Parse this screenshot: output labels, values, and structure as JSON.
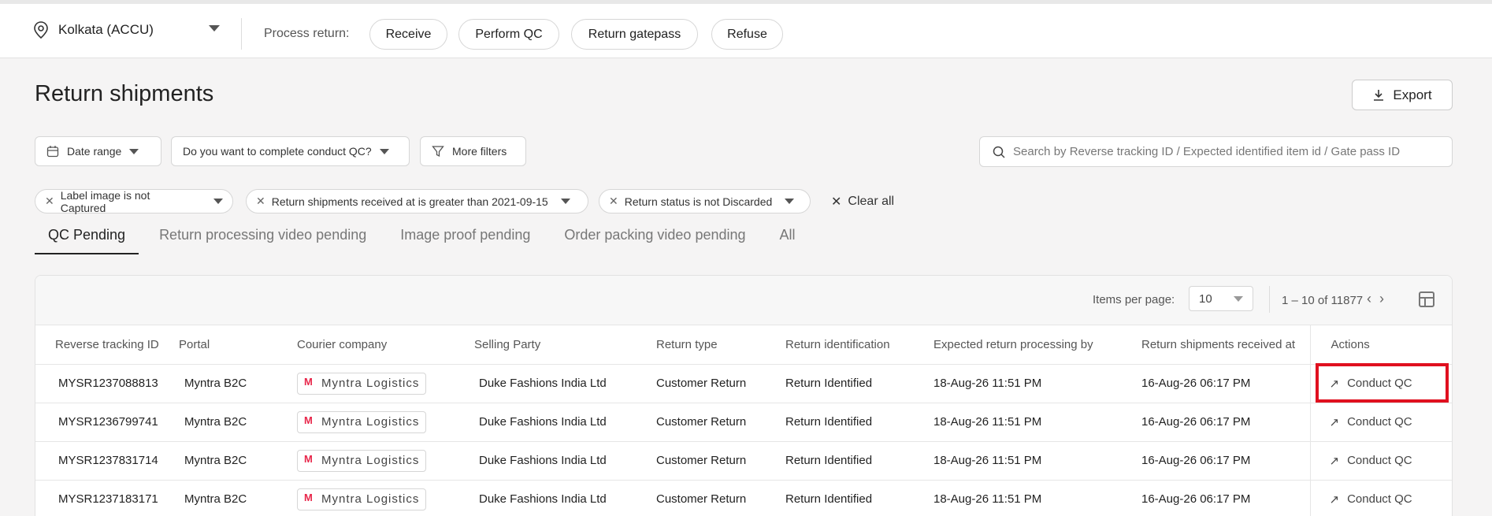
{
  "topbar": {
    "location": "Kolkata (ACCU)",
    "process_label": "Process return:",
    "actions": [
      "Receive",
      "Perform QC",
      "Return gatepass",
      "Refuse"
    ]
  },
  "page": {
    "title": "Return shipments",
    "export_label": "Export"
  },
  "filters": {
    "date_range": "Date range",
    "conduct_qc": "Do you want to complete conduct QC?",
    "more_filters": "More filters",
    "search_placeholder": "Search by Reverse tracking ID / Expected identified item id / Gate pass ID"
  },
  "chips": [
    "Label image is not Captured",
    "Return shipments received at is greater than 2021-09-15",
    "Return status is not Discarded"
  ],
  "clear_all": "Clear all",
  "tabs": [
    "QC Pending",
    "Return processing video pending",
    "Image proof pending",
    "Order packing video pending",
    "All"
  ],
  "pagination": {
    "items_per_page_label": "Items per page:",
    "items_per_page": "10",
    "range": "1 – 10 of 11877"
  },
  "table": {
    "headers": [
      "Reverse tracking ID",
      "Portal",
      "Courier company",
      "Selling Party",
      "Return type",
      "Return identification",
      "Expected return processing by",
      "Return shipments received at",
      "Actions"
    ],
    "rows": [
      {
        "id": "MYSR1237088813",
        "portal": "Myntra B2C",
        "courier": "Myntra Logistics",
        "party": "Duke Fashions India Ltd",
        "type": "Customer Return",
        "ident": "Return Identified",
        "expected": "18-Aug-26 11:51 PM",
        "received": "16-Aug-26 06:17 PM",
        "action": "Conduct QC"
      },
      {
        "id": "MYSR1236799741",
        "portal": "Myntra B2C",
        "courier": "Myntra Logistics",
        "party": "Duke Fashions India Ltd",
        "type": "Customer Return",
        "ident": "Return Identified",
        "expected": "18-Aug-26 11:51 PM",
        "received": "16-Aug-26 06:17 PM",
        "action": "Conduct QC"
      },
      {
        "id": "MYSR1237831714",
        "portal": "Myntra B2C",
        "courier": "Myntra Logistics",
        "party": "Duke Fashions India Ltd",
        "type": "Customer Return",
        "ident": "Return Identified",
        "expected": "18-Aug-26 11:51 PM",
        "received": "16-Aug-26 06:17 PM",
        "action": "Conduct QC"
      },
      {
        "id": "MYSR1237183171",
        "portal": "Myntra B2C",
        "courier": "Myntra Logistics",
        "party": "Duke Fashions India Ltd",
        "type": "Customer Return",
        "ident": "Return Identified",
        "expected": "18-Aug-26 11:51 PM",
        "received": "16-Aug-26 06:17 PM",
        "action": "Conduct QC"
      }
    ]
  },
  "colors": {
    "highlight": "#e0101f",
    "courier_logo": "#e8264a"
  }
}
